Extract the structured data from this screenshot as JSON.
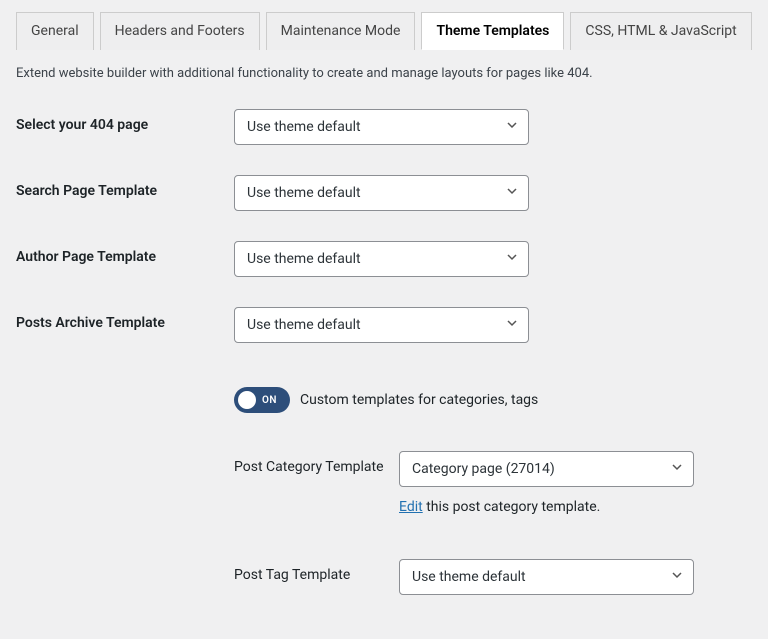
{
  "tabs": {
    "general": "General",
    "headers": "Headers and Footers",
    "maintenance": "Maintenance Mode",
    "theme_templates": "Theme Templates",
    "css_html_js": "CSS, HTML & JavaScript"
  },
  "description": "Extend website builder with additional functionality to create and manage layouts for pages like 404.",
  "fields": {
    "page_404": {
      "label": "Select your 404 page",
      "value": "Use theme default"
    },
    "search": {
      "label": "Search Page Template",
      "value": "Use theme default"
    },
    "author": {
      "label": "Author Page Template",
      "value": "Use theme default"
    },
    "posts_archive": {
      "label": "Posts Archive Template",
      "value": "Use theme default"
    }
  },
  "toggle": {
    "state_label": "ON",
    "text": "Custom templates for categories, tags"
  },
  "sub": {
    "category": {
      "label": "Post Category Template",
      "value": "Category page (27014)"
    },
    "hint_edit": "Edit",
    "hint_rest": " this post category template.",
    "tag": {
      "label": "Post Tag Template",
      "value": "Use theme default"
    }
  }
}
